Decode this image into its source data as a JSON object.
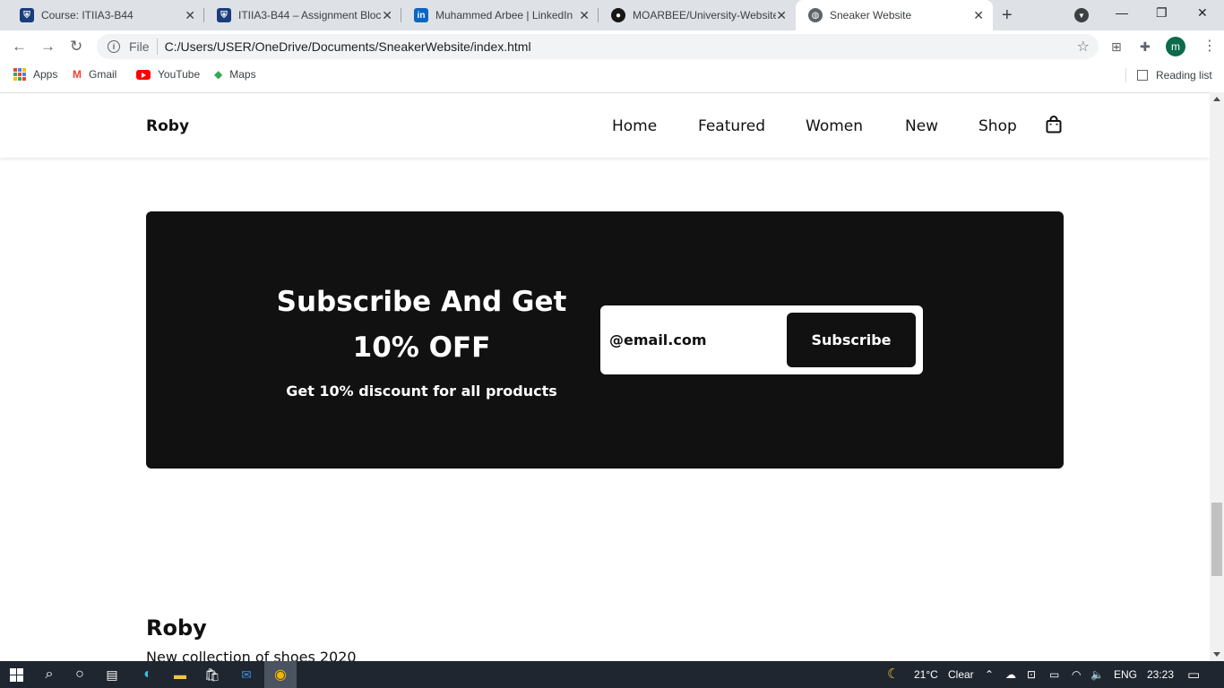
{
  "browser": {
    "tabs": [
      {
        "title": "Course: ITIIA3-B44",
        "icon": "university-shield-icon",
        "color": "#1a3d7c"
      },
      {
        "title": "ITIIA3-B44 – Assignment Bloc",
        "icon": "university-shield-icon",
        "color": "#1a3d7c"
      },
      {
        "title": "Muhammed Arbee | LinkedIn",
        "icon": "linkedin-icon",
        "color": "#0a66c2"
      },
      {
        "title": "MOARBEE/University-Website",
        "icon": "github-icon",
        "color": "#181717"
      },
      {
        "title": "Sneaker Website",
        "icon": "globe-icon",
        "color": "#5f6368",
        "active": true
      }
    ],
    "address": {
      "scheme_label": "File",
      "url": "C:/Users/USER/OneDrive/Documents/SneakerWebsite/index.html"
    },
    "profile_initial": "m",
    "bookmarks": [
      {
        "label": "Apps",
        "icon": "apps-grid-icon"
      },
      {
        "label": "Gmail",
        "icon": "gmail-icon"
      },
      {
        "label": "YouTube",
        "icon": "youtube-icon"
      },
      {
        "label": "Maps",
        "icon": "maps-icon"
      }
    ],
    "reading_list_label": "Reading list"
  },
  "page": {
    "logo": "Roby",
    "nav": [
      "Home",
      "Featured",
      "Women",
      "New",
      "Shop"
    ],
    "subscribe": {
      "title_line1": "Subscribe And Get",
      "title_line2": "10% OFF",
      "subtitle": "Get 10% discount for all products",
      "input_placeholder": "@email.com",
      "button_label": "Subscribe"
    },
    "footer": {
      "logo": "Roby",
      "text": "New collection of shoes 2020"
    }
  },
  "taskbar": {
    "weather_temp": "21°C",
    "weather_desc": "Clear",
    "language": "ENG",
    "time": "23:23"
  },
  "colors": {
    "accent_dark": "#111111",
    "browser_tabbar": "#dee1e6",
    "taskbar": "#1f2630"
  }
}
